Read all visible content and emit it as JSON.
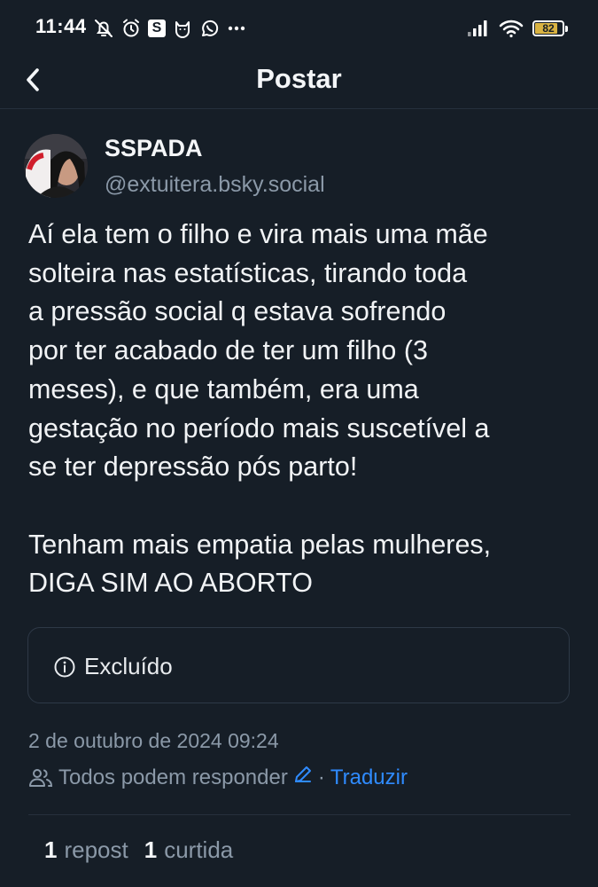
{
  "status_bar": {
    "time": "11:44",
    "notification_icons": [
      "bell-off-icon",
      "alarm-icon",
      "s-app-icon",
      "cat-app-icon",
      "whatsapp-icon",
      "more-dots-icon"
    ],
    "s_icon_letter": "S",
    "signal_icon": "signal-icon",
    "wifi_icon": "wifi-icon",
    "battery_level": "82",
    "battery_color": "#d9b342"
  },
  "header": {
    "back_icon": "chevron-left-icon",
    "title": "Postar"
  },
  "post": {
    "author_name": "SSPADA",
    "author_handle": "@extuitera.bsky.social",
    "paragraphs": [
      "Aí ela tem o filho e vira mais uma mãe\nsolteira nas estatísticas, tirando toda\na pressão social q estava sofrendo\npor ter acabado de ter um filho (3\nmeses), e que também, era uma\ngestação no período mais suscetível a\nse ter depressão pós parto!",
      "Tenham mais empatia pelas mulheres,\nDIGA SIM AO ABORTO"
    ],
    "quote": {
      "icon": "info-icon",
      "label": "Excluído"
    },
    "date": "2 de outubro de 2024 09:24",
    "reply_setting": {
      "icon": "people-icon",
      "label": "Todos podem responder",
      "edit_icon": "pencil-icon",
      "separator": "·",
      "translate_label": "Traduzir"
    },
    "stats": {
      "reposts_count": "1",
      "reposts_label": "repost",
      "likes_count": "1",
      "likes_label": "curtida"
    }
  },
  "colors": {
    "background": "#161e27",
    "text_primary": "#f1f3f5",
    "text_secondary": "#8b99a8",
    "link": "#2f8bff",
    "border": "#26303c"
  }
}
